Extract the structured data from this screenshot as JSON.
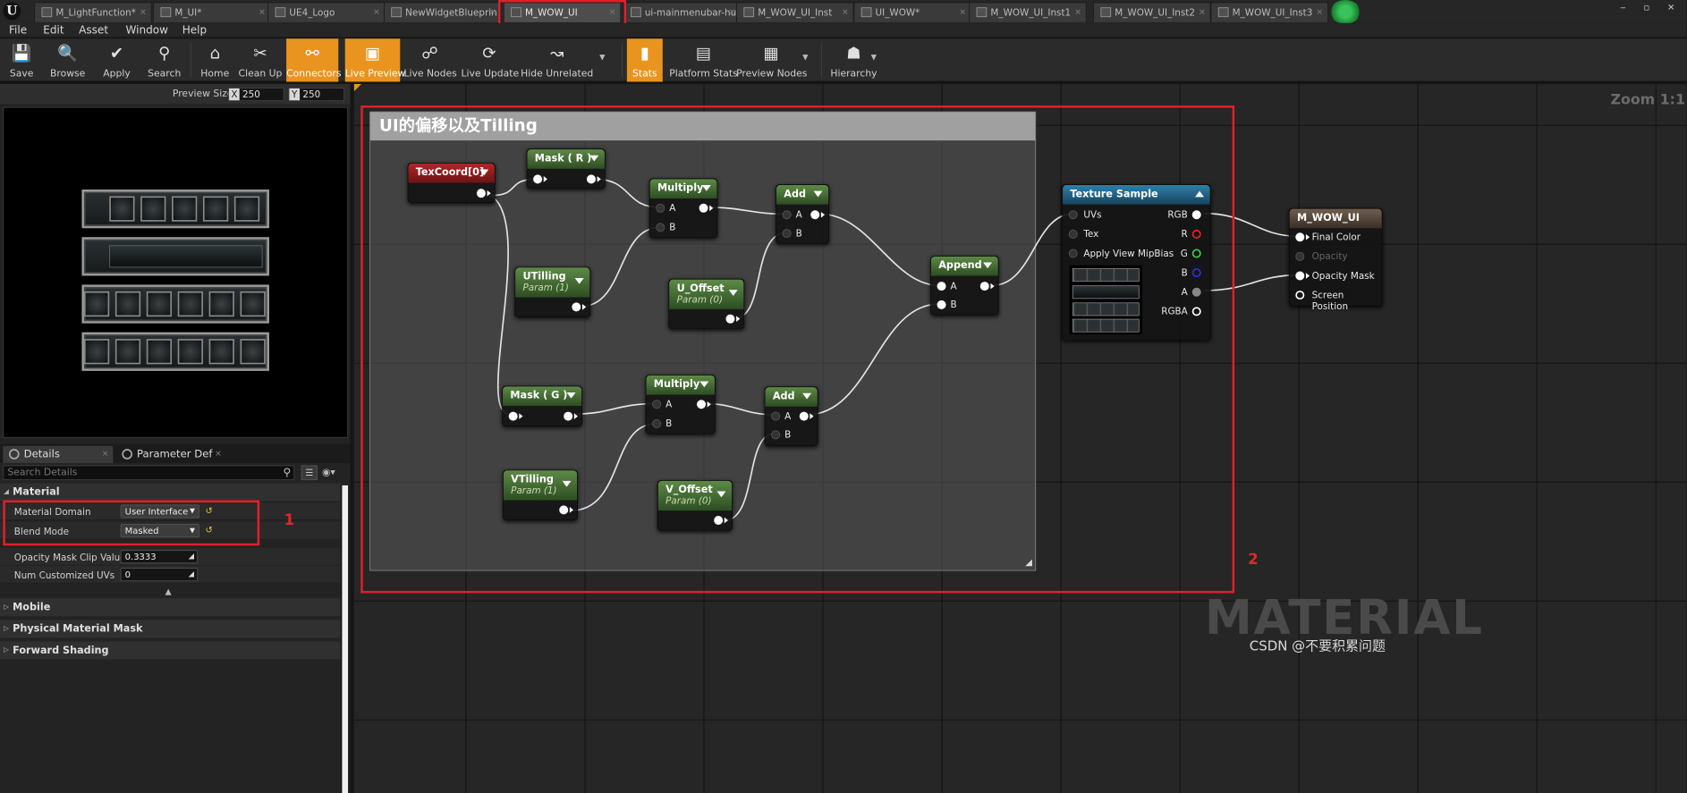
{
  "tabs": [
    {
      "label": "M_LightFunction*",
      "active": false
    },
    {
      "label": "M_UI*",
      "active": false
    },
    {
      "label": "UE4_Logo",
      "active": false
    },
    {
      "label": "NewWidgetBlueprin",
      "active": false
    },
    {
      "label": "M_WOW_UI",
      "active": true
    },
    {
      "label": "ui-mainmenubar-hu",
      "active": false
    },
    {
      "label": "M_WOW_UI_Inst",
      "active": false
    },
    {
      "label": "UI_WOW*",
      "active": false
    },
    {
      "label": "M_WOW_UI_Inst1",
      "active": false
    },
    {
      "label": "M_WOW_UI_Inst2",
      "active": false
    },
    {
      "label": "M_WOW_UI_Inst3",
      "active": false
    }
  ],
  "menu": [
    "File",
    "Edit",
    "Asset",
    "Window",
    "Help"
  ],
  "toolbar": [
    {
      "label": "Save",
      "icon": "save-icon",
      "glyph": "💾",
      "on": false
    },
    {
      "label": "Browse",
      "icon": "magnifier-icon",
      "glyph": "🔍",
      "on": false
    },
    {
      "label": "Apply",
      "icon": "checkmark-icon",
      "glyph": "✔",
      "on": false
    },
    {
      "label": "Search",
      "icon": "binoculars-icon",
      "glyph": "⚲",
      "on": false
    },
    {
      "label": "Home",
      "icon": "home-icon",
      "glyph": "⌂",
      "on": false
    },
    {
      "label": "Clean Up",
      "icon": "broom-icon",
      "glyph": "✂",
      "on": false
    },
    {
      "label": "Connectors",
      "icon": "connectors-icon",
      "glyph": "⚯",
      "on": true
    },
    {
      "label": "Live Preview",
      "icon": "live-preview-icon",
      "glyph": "▣",
      "on": true
    },
    {
      "label": "Live Nodes",
      "icon": "live-nodes-icon",
      "glyph": "☍",
      "on": false
    },
    {
      "label": "Live Update",
      "icon": "live-update-icon",
      "glyph": "⟳",
      "on": false
    },
    {
      "label": "Hide Unrelated",
      "icon": "hide-unrelated-icon",
      "glyph": "↝",
      "on": false
    },
    {
      "label": "Stats",
      "icon": "stats-icon",
      "glyph": "▮",
      "on": true
    },
    {
      "label": "Platform Stats",
      "icon": "platform-stats-icon",
      "glyph": "▤",
      "on": false
    },
    {
      "label": "Preview Nodes",
      "icon": "preview-nodes-icon",
      "glyph": "▦",
      "on": false
    },
    {
      "label": "Hierarchy",
      "icon": "hierarchy-icon",
      "glyph": "☗",
      "on": false
    }
  ],
  "preview": {
    "size_label": "Preview Size",
    "x_key": "X",
    "x": "250",
    "y_key": "Y",
    "y": "250"
  },
  "details": {
    "tab1": "Details",
    "tab2": "Parameter Defaults",
    "search_placeholder": "Search Details",
    "category_material": "Material",
    "rows": [
      {
        "label": "Material Domain",
        "value": "User Interface"
      },
      {
        "label": "Blend Mode",
        "value": "Masked"
      },
      {
        "label": "Opacity Mask Clip Value",
        "value": "0.3333"
      },
      {
        "label": "Num Customized UVs",
        "value": "0"
      }
    ],
    "categories": [
      "Mobile",
      "Physical Material Mask",
      "Forward Shading"
    ]
  },
  "annotations": {
    "one": "1",
    "two": "2"
  },
  "graph": {
    "zoom": "Zoom 1:1",
    "comment": "UI的偏移以及Tilling",
    "watermark": "MATERIAL",
    "credit": "CSDN @不要积累问题"
  },
  "nodes": {
    "texcoord": "TexCoord[0]",
    "mask_r": "Mask ( R )",
    "mask_g": "Mask ( G )",
    "multiply": "Multiply",
    "add": "Add",
    "append": "Append",
    "utilling": "UTilling",
    "vtilling": "VTilling",
    "u_offset": "U_Offset",
    "v_offset": "V_Offset",
    "param1": "Param (1)",
    "param0": "Param (0)",
    "pin_a": "A",
    "pin_b": "B",
    "texture_sample": "Texture Sample",
    "ts_inputs": [
      "UVs",
      "Tex",
      "Apply View MipBias"
    ],
    "ts_outputs": [
      "RGB",
      "R",
      "G",
      "B",
      "A",
      "RGBA"
    ],
    "result": "M_WOW_UI",
    "result_inputs": [
      "Final Color",
      "Opacity",
      "Opacity Mask",
      "Screen Position"
    ]
  },
  "colors": {
    "accent": "#e9941e",
    "highlight": "#e0202a",
    "wire": "#e8e8e8"
  }
}
